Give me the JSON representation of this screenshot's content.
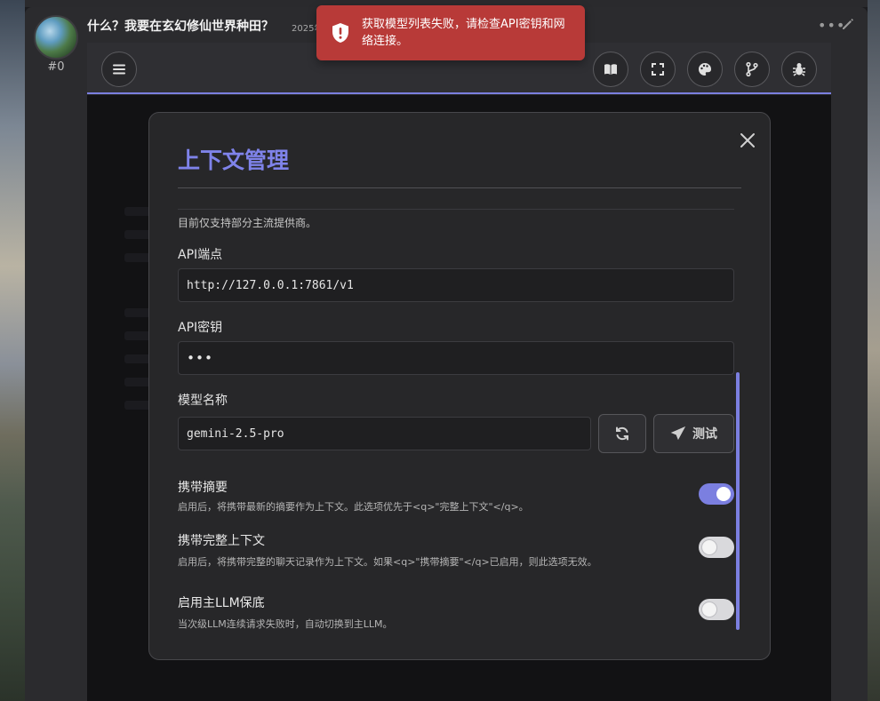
{
  "message": {
    "title": "什么？我要在玄幻修仙世界种田？",
    "date": "2025年",
    "index": "#0"
  },
  "toast": {
    "text": "获取模型列表失败，请检查API密钥和网络连接。",
    "icon": "shield-exclamation-icon",
    "color": "#b83a38"
  },
  "toolbar": {
    "menu_icon": "hamburger-icon",
    "buttons": [
      "book-open-icon",
      "expand-icon",
      "palette-icon",
      "branch-icon",
      "bug-icon"
    ]
  },
  "modal": {
    "title": "上下文管理",
    "note": "目前仅支持部分主流提供商。",
    "api_endpoint": {
      "label": "API端点",
      "value": "http://127.0.0.1:7861/v1"
    },
    "api_key": {
      "label": "API密钥",
      "value": "•••"
    },
    "model_name": {
      "label": "模型名称",
      "value": "gemini-2.5-pro",
      "refresh_icon": "refresh-icon",
      "test_label": "测试",
      "test_icon": "paper-plane-icon"
    },
    "options": [
      {
        "title": "携带摘要",
        "desc": "启用后，将携带最新的摘要作为上下文。此选项优先于<q>\"完整上下文\"</q>。",
        "enabled": true
      },
      {
        "title": "携带完整上下文",
        "desc": "启用后，将携带完整的聊天记录作为上下文。如果<q>\"携带摘要\"</q>已启用，则此选项无效。",
        "enabled": false
      },
      {
        "title": "启用主LLM保底",
        "desc": "当次级LLM连续请求失败时，自动切换到主LLM。",
        "enabled": false
      }
    ]
  },
  "colors": {
    "accent": "#7b7fe0",
    "title": "#7f83ea",
    "toast": "#b83a38"
  }
}
